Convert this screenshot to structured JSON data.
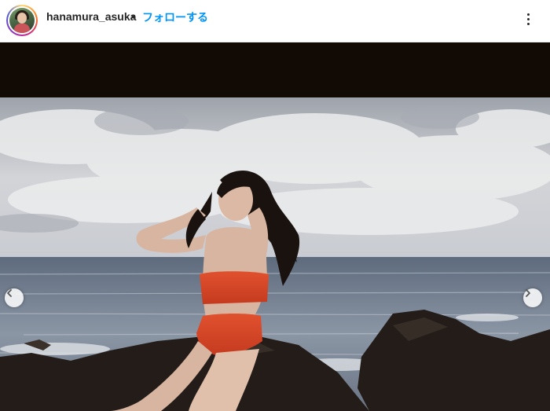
{
  "post_header": {
    "username": "hanamura_asuka",
    "separator": "•",
    "follow_label": "フォローする",
    "follow_color": "#0095f6",
    "more_icon": "more-options-icon"
  },
  "post_media": {
    "description_icon": "photo",
    "prev_icon": "chevron-left-icon",
    "next_icon": "chevron-right-icon"
  }
}
